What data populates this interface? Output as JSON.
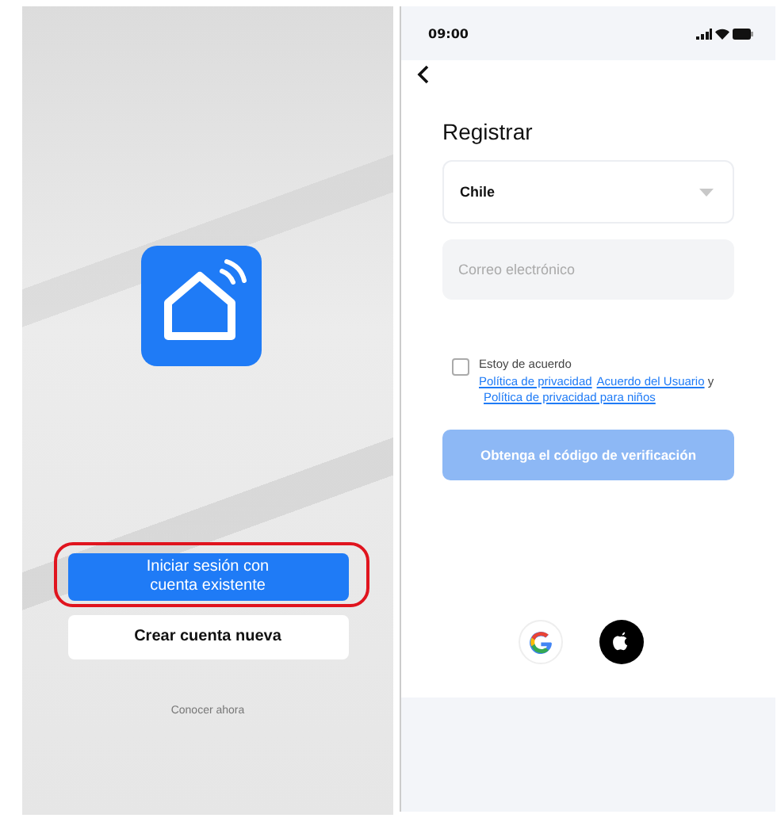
{
  "welcome_screen": {
    "buttons": [
      {
        "label": "Iniciar sesión con cuenta existente",
        "kind": "primary",
        "highlighted": true
      },
      {
        "label": "Crear cuenta nueva",
        "kind": "secondary",
        "highlighted": false
      }
    ],
    "link": "Conocer ahora"
  },
  "register_screen": {
    "status_bar": {
      "time": "09:00"
    },
    "title": "Registrar",
    "country_select": {
      "value": "Chile"
    },
    "email_field": {
      "placeholder": "Correo electrónico"
    },
    "agreement": {
      "checked": false,
      "parts": [
        {
          "kind": "text",
          "text": "Estoy de acuerdo "
        },
        {
          "kind": "link",
          "text": "Política de privacidad"
        },
        {
          "kind": "link",
          "text": "Acuerdo del Usuario"
        },
        {
          "kind": "text",
          "text": " y "
        },
        {
          "kind": "link",
          "text": "Política de privacidad para niños"
        }
      ]
    },
    "submit_button": {
      "label": "Obtenga el código de verificación",
      "disabled": true
    }
  }
}
